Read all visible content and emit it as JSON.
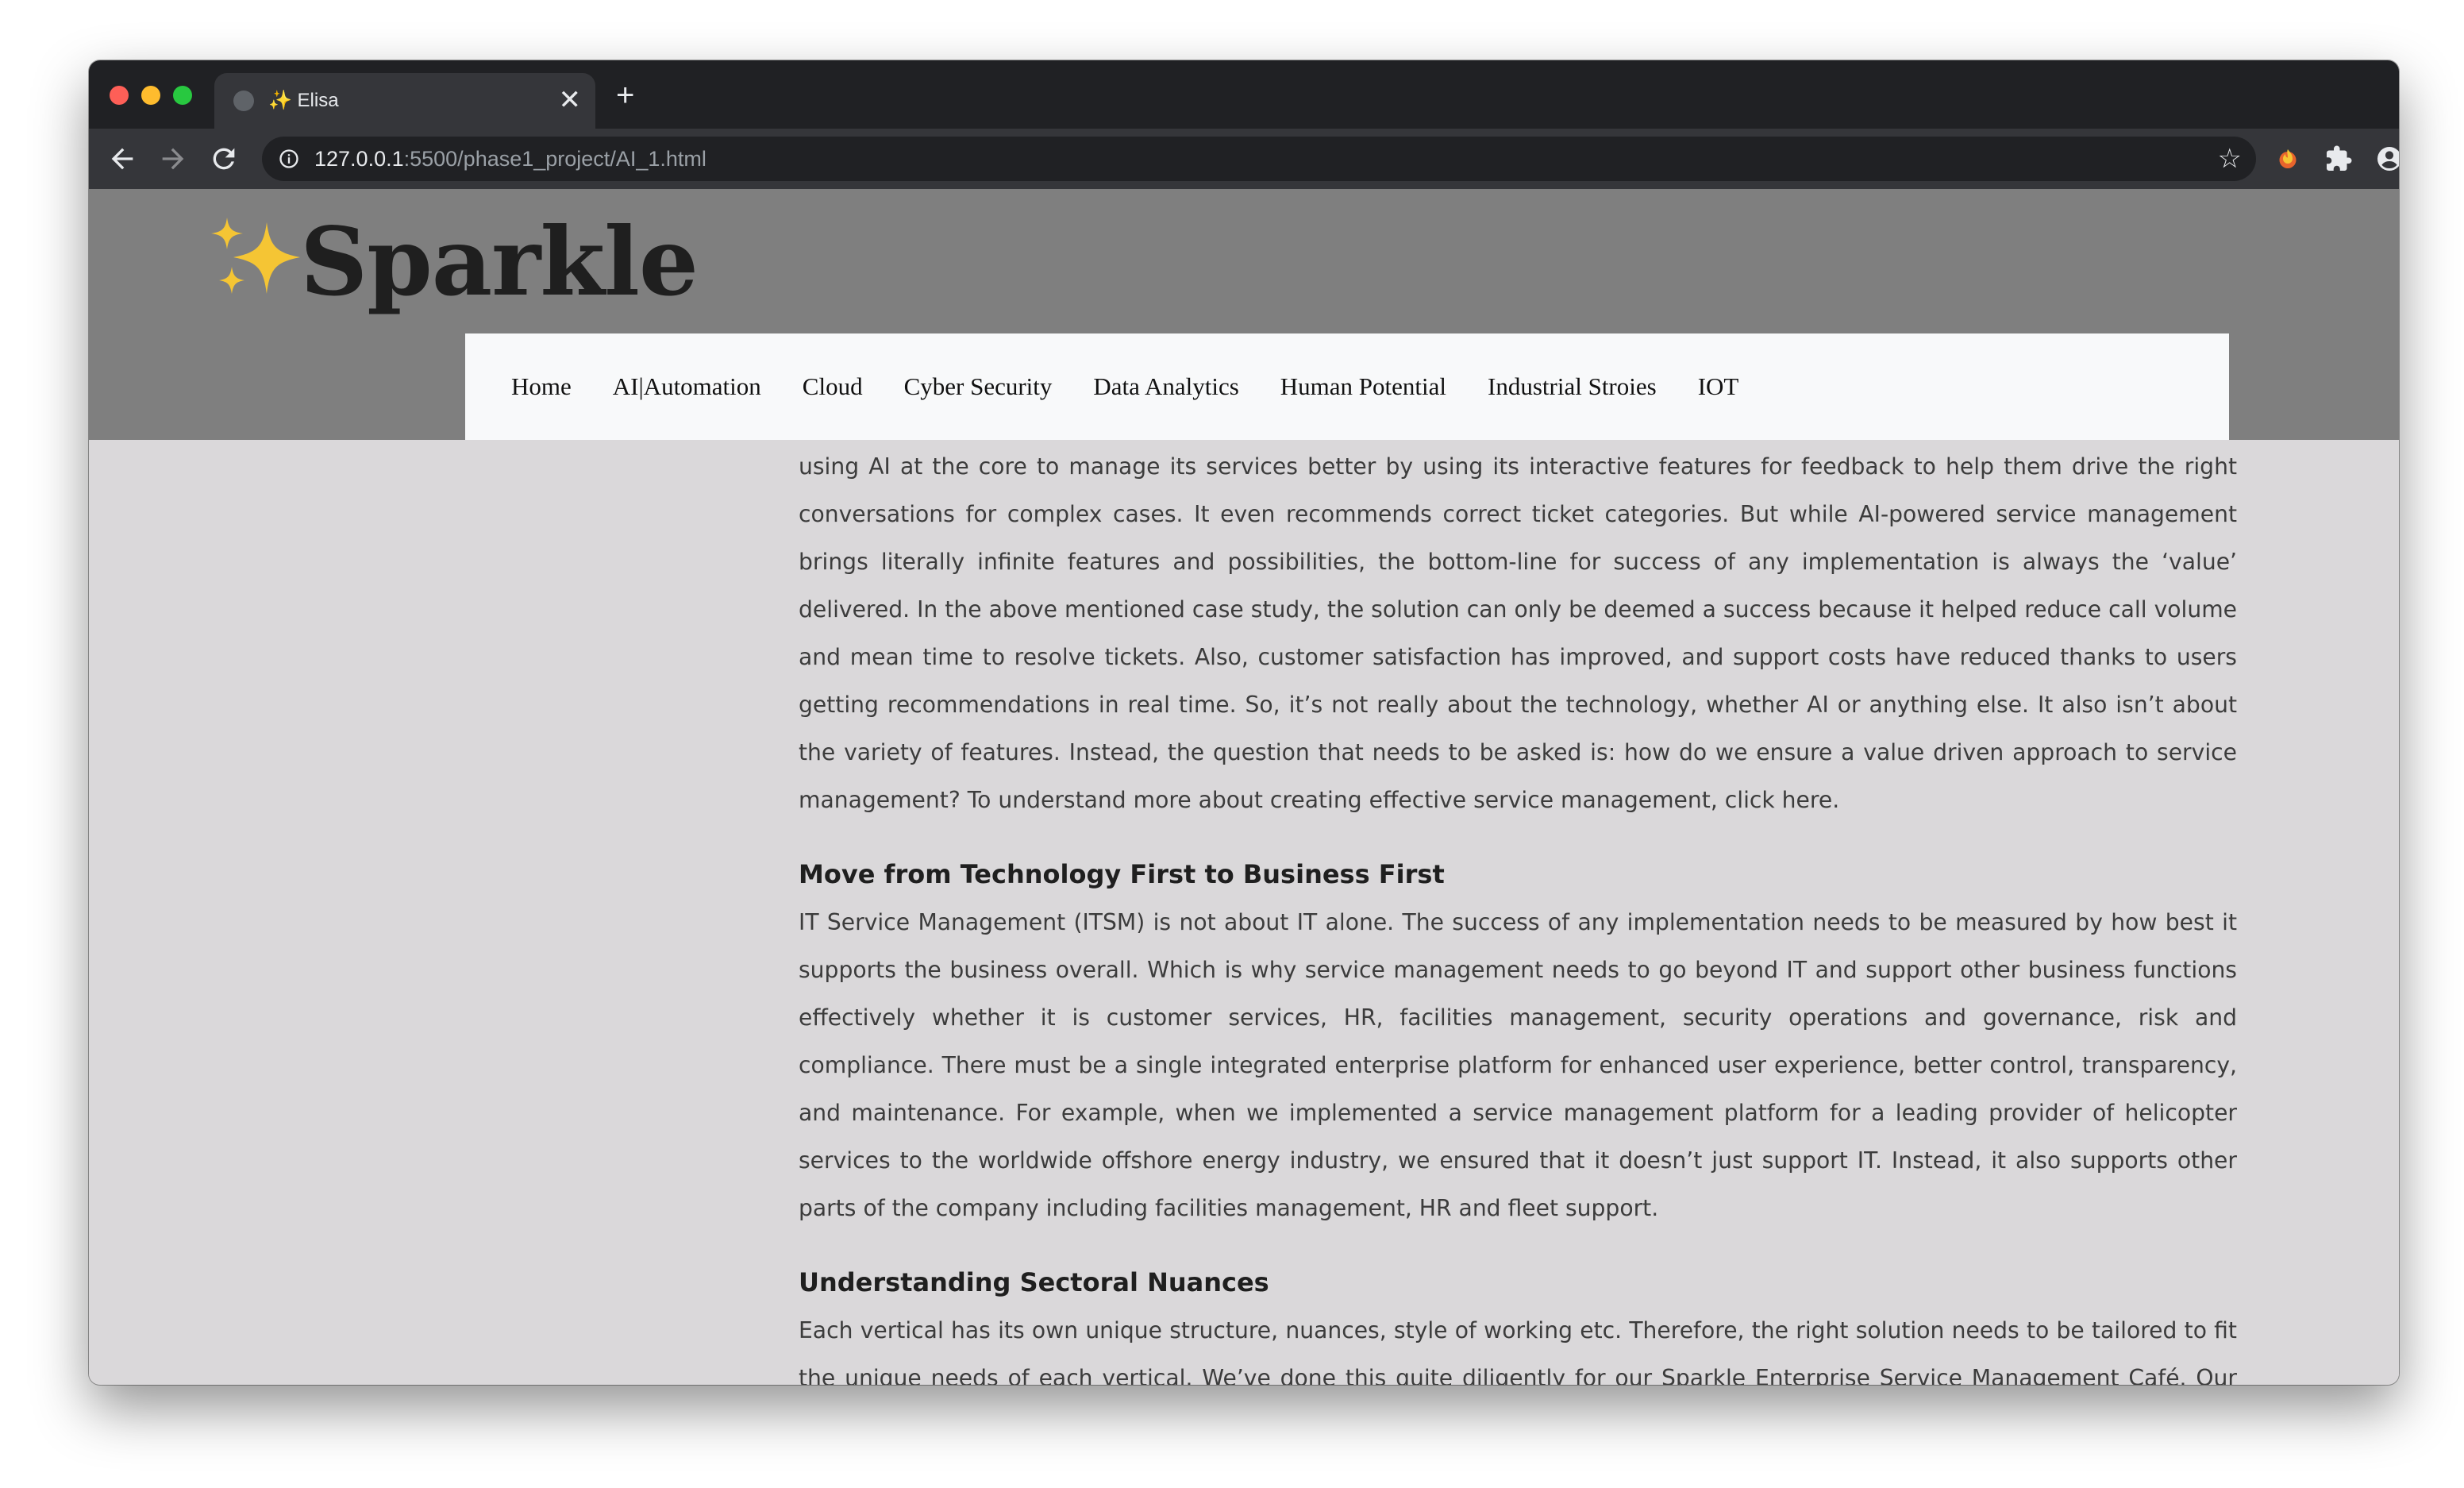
{
  "browser": {
    "tab_title": "✨ Elisa",
    "new_tab_label": "+",
    "tab_close_label": "✕",
    "url_host": "127.0.0.1",
    "url_path": ":5500/phase1_project/AI_1.html",
    "icons": {
      "back": "arrow-left-icon",
      "forward": "arrow-right-icon",
      "reload": "reload-icon",
      "info": "info-icon",
      "bookmark": "star-icon",
      "extension": "extension-flame-icon",
      "extensions": "puzzle-icon",
      "profile": "profile-icon",
      "menu": "kebab-menu-icon"
    }
  },
  "site": {
    "brand": "Sparkle",
    "logo_icon": "sparkles-icon",
    "colors": {
      "header_bg": "#7f7f7f",
      "page_bg": "#dad8da",
      "nav_bg": "#f8f9fa",
      "sparkle": "#f5c534"
    },
    "nav": [
      "Home",
      "AI|Automation",
      "Cloud",
      "Cyber Security",
      "Data Analytics",
      "Human Potential",
      "Industrial Stroies",
      "IOT"
    ]
  },
  "article": {
    "para1": "using AI at the core to manage its services better by using its interactive features for feedback to help them drive the right conversations for complex cases. It even recommends correct ticket categories. But while AI-powered service management brings literally infinite features and possibilities, the bottom-line for success of any implementation is always the ‘value’ delivered. In the above mentioned case study, the solution can only be deemed a success because it helped reduce call volume and mean time to resolve tickets. Also, customer satisfaction has improved, and support costs have reduced thanks to users getting recommendations in real time. So, it’s not really about the technology, whether AI or anything else. It also isn’t about the variety of features. Instead, the question that needs to be asked is: how do we ensure a value driven approach to service management? To understand more about creating effective service management, click here.",
    "heading2": "Move from Technology First to Business First",
    "para2": "IT Service Management (ITSM) is not about IT alone. The success of any implementation needs to be measured by how best it supports the business overall. Which is why service management needs to go beyond IT and support other business functions effectively whether it is customer services, HR, facilities management, security operations and governance, risk and compliance. There must be a single integrated enterprise platform for enhanced user experience, better control, transparency, and maintenance. For example, when we implemented a service management platform for a leading provider of helicopter services to the worldwide offshore energy industry, we ensured that it doesn’t just support IT. Instead, it also supports other parts of the company including facilities management, HR and fleet support.",
    "heading3": "Understanding Sectoral Nuances",
    "para3": "Each vertical has its own unique structure, nuances, style of working etc. Therefore, the right solution needs to be tailored to fit the unique needs of each vertical. We’ve done this quite diligently for our Sparkle Enterprise Service Management Café. Our service"
  }
}
